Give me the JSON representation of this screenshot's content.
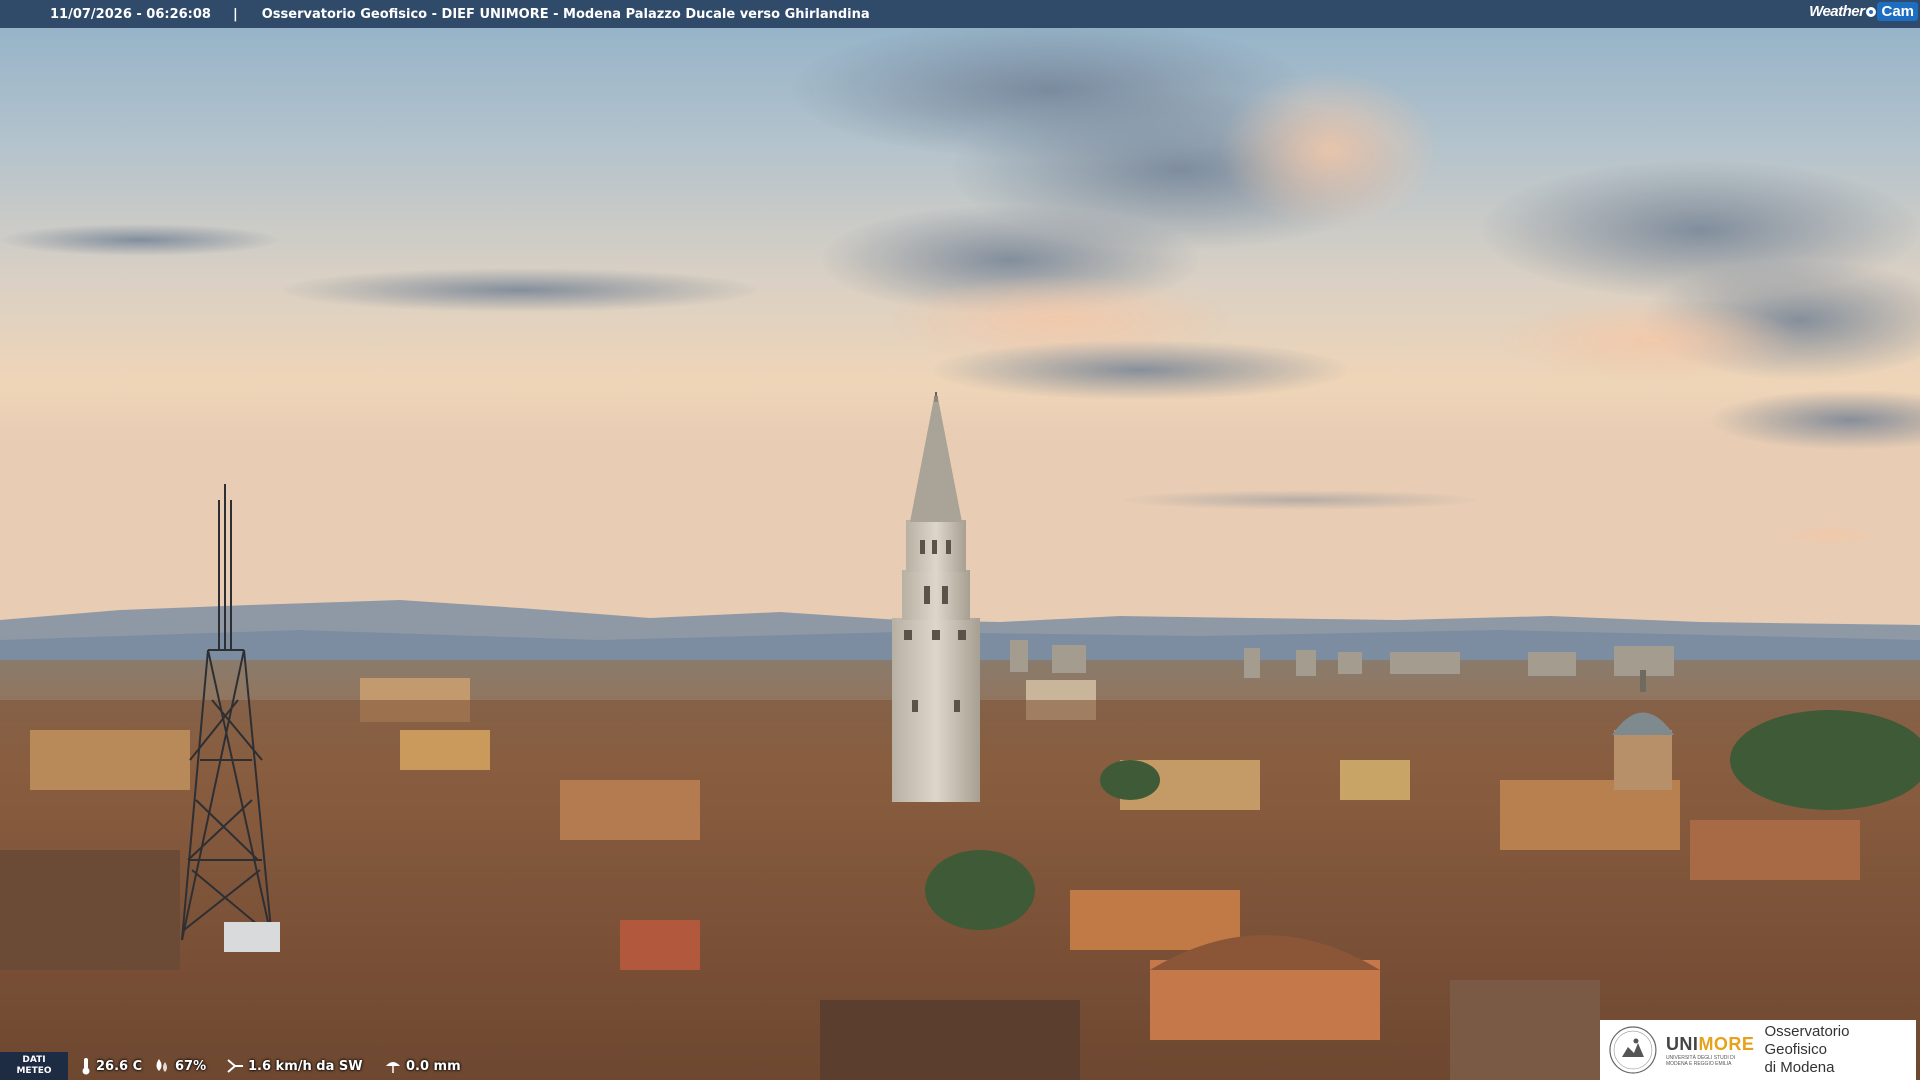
{
  "header": {
    "timestamp": "11/07/2026 - 06:26:08",
    "separator": "|",
    "title": "Osservatorio Geofisico - DIEF UNIMORE - Modena Palazzo Ducale verso Ghirlandina"
  },
  "brand_logo": {
    "weather": "Weather",
    "cam": "Cam"
  },
  "weather": {
    "label_line1": "DATI",
    "label_line2": "METEO",
    "temperature": "26.6 C",
    "humidity": "67%",
    "wind": "1.6 km/h da SW",
    "rain": "0.0 mm"
  },
  "institution": {
    "uni": "UNI",
    "more": "MORE",
    "subtitle_line1": "UNIVERSITÀ DEGLI STUDI DI",
    "subtitle_line2": "MODENA E REGGIO EMILIA",
    "observatory_line1": "Osservatorio Geofisico",
    "observatory_line2": "di Modena"
  },
  "colors": {
    "sky_top": "#8fb0c8",
    "sky_horizon": "#eed2b4",
    "roof": "#8a5a3c",
    "tower": "#cfc7b8",
    "bar_blue": "#142d50",
    "unimore_orange": "#e6a21d"
  },
  "icons": [
    "thermometer-icon",
    "humidity-icon",
    "wind-icon",
    "rain-gauge-icon",
    "unimore-seal-icon",
    "weathercam-logo-icon"
  ]
}
